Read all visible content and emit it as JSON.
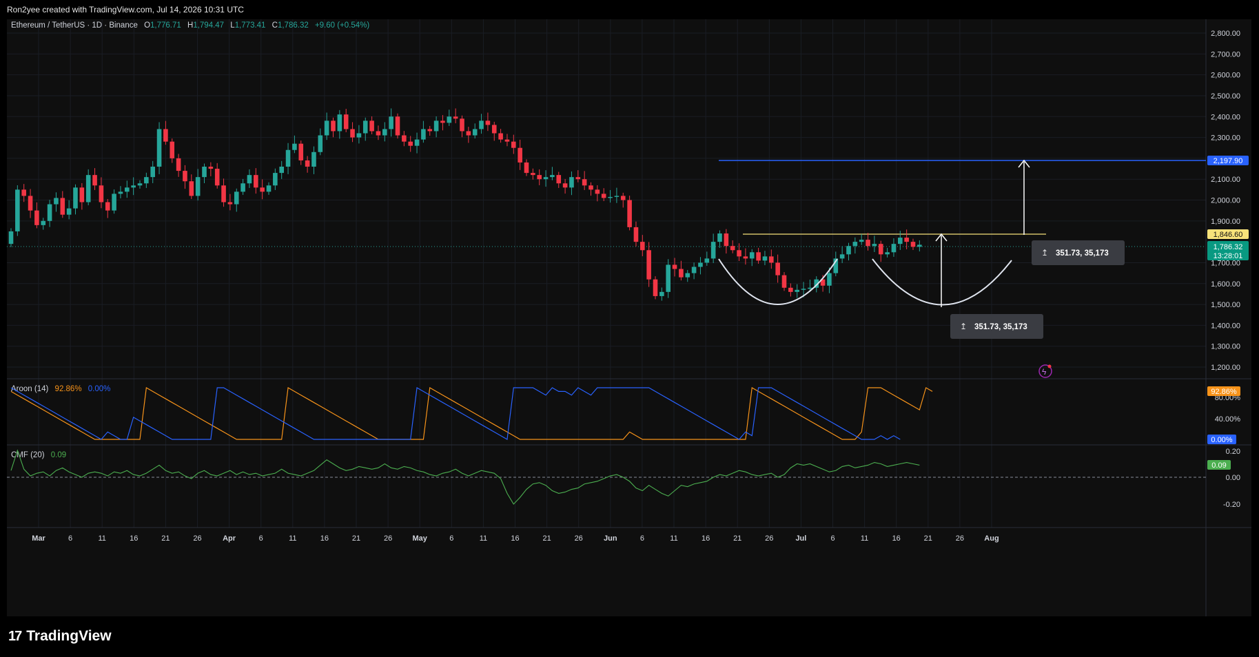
{
  "header": {
    "credit": "Ron2yee created with TradingView.com, Jul 14, 2026 10:31 UTC"
  },
  "symbol": {
    "name": "Ethereum / TetherUS · 1D · Binance",
    "open_label": "O",
    "open": "1,776.71",
    "high_label": "H",
    "high": "1,794.47",
    "low_label": "L",
    "low": "1,773.41",
    "close_label": "C",
    "close": "1,786.32",
    "change": "+9.60 (+0.54%)"
  },
  "price_axis": {
    "ticks": [
      "2,800.00",
      "2,700.00",
      "2,600.00",
      "2,500.00",
      "2,400.00",
      "2,300.00",
      "2,200.00",
      "2,100.00",
      "2,000.00",
      "1,900.00",
      "1,700.00",
      "1,600.00",
      "1,500.00",
      "1,400.00",
      "1,300.00",
      "1,200.00"
    ],
    "target_label": "2,197.90",
    "neckline_label": "1,846.60",
    "last_price_label": "1,786.32",
    "countdown": "13:28:01"
  },
  "time_axis": [
    "Mar",
    "6",
    "11",
    "16",
    "21",
    "26",
    "Apr",
    "6",
    "11",
    "16",
    "21",
    "26",
    "May",
    "6",
    "11",
    "16",
    "21",
    "26",
    "Jun",
    "6",
    "11",
    "16",
    "21",
    "26",
    "Jul",
    "6",
    "11",
    "16",
    "21",
    "26",
    "Aug"
  ],
  "annotations": {
    "measure_1": "351.73, 35,173",
    "measure_2": "351.73, 35,173"
  },
  "aroon": {
    "title": "Aroon (14)",
    "up_value": "92.86%",
    "down_value": "0.00%",
    "ticks": [
      "80.00%",
      "40.00%"
    ],
    "up_color": "#f7931a",
    "down_color": "#2962ff"
  },
  "cmf": {
    "title": "CMF (20)",
    "value": "0.09",
    "ticks": [
      "0.20",
      "0.00",
      "-0.20"
    ],
    "color": "#4caf50"
  },
  "footer": {
    "brand": "TradingView"
  },
  "colors": {
    "up": "#26a69a",
    "down": "#f23645",
    "background": "#0f0f0f",
    "target_line": "#2962ff",
    "neckline": "#f7e27a"
  },
  "chart_data": {
    "type": "candlestick",
    "title": "Ethereum / TetherUS · 1D · Binance",
    "y_range": [
      1130,
      2870
    ],
    "x_range": [
      "2026-02-25",
      "2026-08-05"
    ],
    "target_price": 2197.9,
    "neckline": 1846.6,
    "last_price": 1786.32,
    "closes": [
      1850,
      2050,
      2020,
      1950,
      1880,
      1900,
      1980,
      2010,
      1930,
      1960,
      2060,
      1990,
      2120,
      2070,
      1990,
      1950,
      2030,
      2040,
      2060,
      2070,
      2080,
      2110,
      2160,
      2340,
      2280,
      2200,
      2140,
      2090,
      2020,
      2110,
      2160,
      2150,
      2070,
      1990,
      1980,
      2040,
      2080,
      2120,
      2060,
      2040,
      2070,
      2130,
      2160,
      2240,
      2270,
      2190,
      2160,
      2230,
      2310,
      2380,
      2330,
      2410,
      2340,
      2300,
      2320,
      2380,
      2330,
      2310,
      2340,
      2400,
      2310,
      2280,
      2260,
      2290,
      2340,
      2330,
      2380,
      2370,
      2400,
      2390,
      2330,
      2310,
      2340,
      2380,
      2360,
      2320,
      2290,
      2280,
      2250,
      2180,
      2130,
      2120,
      2100,
      2110,
      2120,
      2080,
      2060,
      2110,
      2100,
      2070,
      2050,
      2030,
      2010,
      2015,
      2020,
      2000,
      1870,
      1800,
      1760,
      1620,
      1540,
      1560,
      1690,
      1670,
      1630,
      1650,
      1680,
      1700,
      1720,
      1800,
      1840,
      1780,
      1760,
      1730,
      1720,
      1750,
      1710,
      1730,
      1700,
      1640,
      1580,
      1560,
      1570,
      1575,
      1580,
      1620,
      1590,
      1650,
      1720,
      1740,
      1780,
      1800,
      1810,
      1780,
      1790,
      1740,
      1750,
      1790,
      1820,
      1800,
      1776,
      1786
    ],
    "aroon_up": [
      92.86,
      85.71,
      78.57,
      71.43,
      64.29,
      57.14,
      50,
      42.86,
      35.71,
      28.57,
      21.43,
      14.29,
      7.14,
      0,
      0,
      0,
      0,
      0,
      0,
      0,
      0,
      100,
      92.86,
      85.71,
      78.57,
      71.43,
      64.29,
      57.14,
      50,
      42.86,
      35.71,
      28.57,
      21.43,
      14.29,
      7.14,
      0,
      0,
      0,
      0,
      0,
      0,
      0,
      0,
      100,
      92.86,
      85.71,
      78.57,
      71.43,
      64.29,
      57.14,
      50,
      42.86,
      35.71,
      28.57,
      21.43,
      14.29,
      7.14,
      0,
      0,
      0,
      0,
      0,
      0,
      0,
      0,
      100,
      92.86,
      85.71,
      78.57,
      71.43,
      64.29,
      57.14,
      50,
      42.86,
      35.71,
      28.57,
      21.43,
      14.29,
      7.14,
      0,
      0,
      0,
      0,
      0,
      0,
      0,
      0,
      0,
      0,
      0,
      0,
      0,
      0,
      0,
      0,
      0,
      14.29,
      7.14,
      0,
      0,
      0,
      0,
      0,
      0,
      0,
      0,
      0,
      0,
      0,
      0,
      0,
      0,
      0,
      0,
      0,
      100,
      92.86,
      85.71,
      78.57,
      71.43,
      64.29,
      57.14,
      50,
      42.86,
      35.71,
      28.57,
      21.43,
      14.29,
      7.14,
      0,
      0,
      0,
      14.29,
      100,
      100,
      100,
      92.86,
      85.71,
      78.57,
      71.43,
      64.29,
      57.14,
      100,
      92.86
    ],
    "aroon_down": [
      100,
      92.86,
      85.71,
      78.57,
      71.43,
      64.29,
      57.14,
      50,
      42.86,
      35.71,
      28.57,
      21.43,
      14.29,
      7.14,
      0,
      14.29,
      7.14,
      0,
      0,
      42.86,
      35.71,
      28.57,
      21.43,
      14.29,
      7.14,
      0,
      0,
      0,
      0,
      0,
      0,
      0,
      100,
      100,
      92.86,
      85.71,
      78.57,
      71.43,
      64.29,
      57.14,
      50,
      42.86,
      35.71,
      28.57,
      21.43,
      14.29,
      7.14,
      0,
      0,
      0,
      0,
      0,
      0,
      0,
      0,
      0,
      0,
      0,
      0,
      0,
      0,
      0,
      0,
      100,
      92.86,
      85.71,
      78.57,
      71.43,
      64.29,
      57.14,
      50,
      42.86,
      35.71,
      28.57,
      21.43,
      14.29,
      7.14,
      0,
      100,
      100,
      100,
      100,
      92.86,
      85.71,
      100,
      92.86,
      92.86,
      85.71,
      100,
      92.86,
      85.71,
      100,
      100,
      100,
      100,
      100,
      100,
      100,
      100,
      100,
      92.86,
      85.71,
      78.57,
      71.43,
      64.29,
      57.14,
      50,
      42.86,
      35.71,
      28.57,
      21.43,
      14.29,
      7.14,
      0,
      14.29,
      7.14,
      100,
      100,
      100,
      92.86,
      85.71,
      78.57,
      71.43,
      64.29,
      57.14,
      50,
      42.86,
      35.71,
      28.57,
      21.43,
      14.29,
      7.14,
      0,
      0,
      0,
      7.14,
      0,
      7.14,
      0
    ],
    "cmf": [
      0.05,
      0.2,
      0.06,
      0.01,
      0.03,
      0.04,
      0.01,
      0.05,
      0.07,
      0.04,
      0.02,
      0,
      0.03,
      0.04,
      0.03,
      0.01,
      0.04,
      0.03,
      0.05,
      0.02,
      0.01,
      0.03,
      0.06,
      0.09,
      0.05,
      0.03,
      0.04,
      0.01,
      -0.01,
      0.03,
      0.05,
      0.02,
      0.01,
      0.03,
      0.05,
      0.02,
      0.04,
      0.02,
      0.03,
      0.01,
      0.02,
      0.03,
      0.06,
      0.03,
      0.02,
      0.01,
      0.03,
      0.05,
      0.09,
      0.13,
      0.1,
      0.07,
      0.05,
      0.06,
      0.08,
      0.07,
      0.06,
      0.07,
      0.1,
      0.07,
      0.06,
      0.08,
      0.07,
      0.05,
      0.04,
      0.02,
      0.01,
      0.03,
      0.04,
      0.06,
      0.03,
      0.01,
      0.03,
      0.05,
      0.04,
      0.03,
      -0.01,
      -0.12,
      -0.2,
      -0.15,
      -0.09,
      -0.05,
      -0.04,
      -0.06,
      -0.1,
      -0.12,
      -0.11,
      -0.09,
      -0.08,
      -0.05,
      -0.04,
      -0.03,
      -0.01,
      0.01,
      0.02,
      0,
      -0.03,
      -0.08,
      -0.1,
      -0.06,
      -0.09,
      -0.12,
      -0.14,
      -0.1,
      -0.06,
      -0.07,
      -0.05,
      -0.04,
      -0.03,
      0,
      0.02,
      0.01,
      0.03,
      0.05,
      0.04,
      0.02,
      0.01,
      0.02,
      0.03,
      0,
      0.02,
      0.07,
      0.1,
      0.09,
      0.1,
      0.08,
      0.06,
      0.04,
      0.05,
      0.08,
      0.09,
      0.07,
      0.08,
      0.09,
      0.11,
      0.1,
      0.08,
      0.09,
      0.1,
      0.11,
      0.1,
      0.09
    ]
  }
}
